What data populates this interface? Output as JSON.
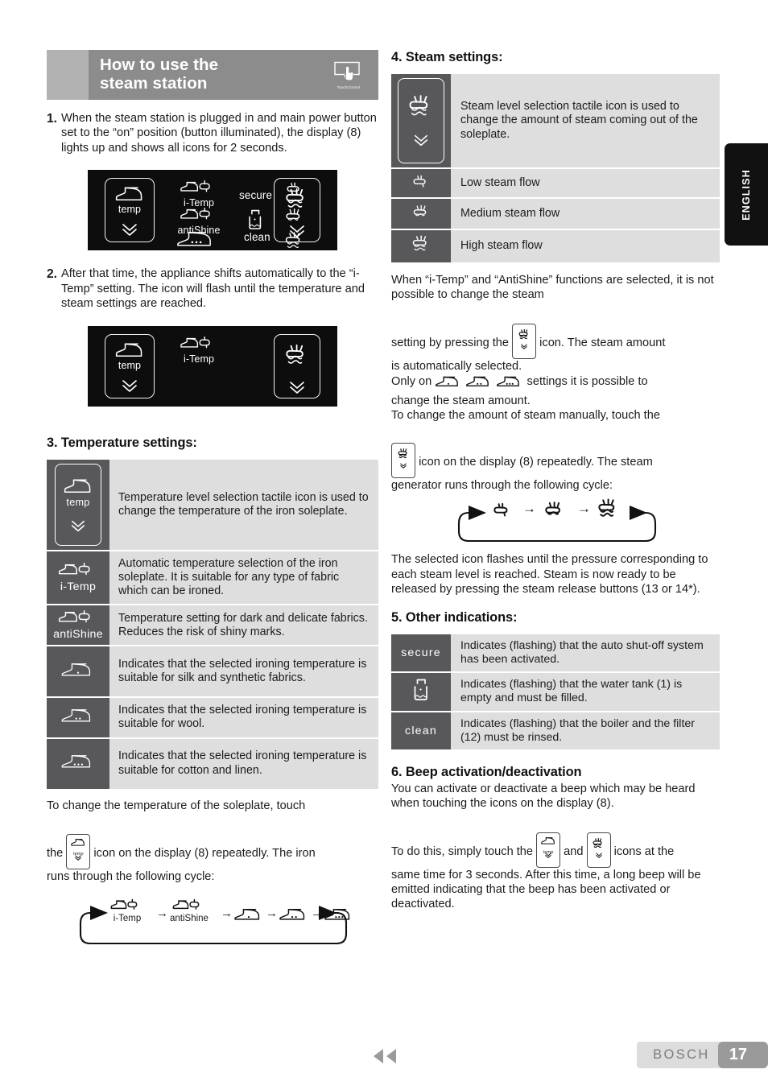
{
  "header": {
    "title": "How to use the\nsteam station",
    "touch_control_label": "TouchControl",
    "touch_control_icon": "hand-touch-icon"
  },
  "language_tab": {
    "label": "ENGLISH"
  },
  "steps": {
    "step1_number": "1.",
    "step1_text": "When the steam station is plugged in and main power button set to the “on” position (button illuminated), the display (8) lights up and shows all icons for 2 seconds.",
    "step2_number": "2.",
    "step2_text": "After that time, the appliance shifts automatically to the “i-Temp” setting. The icon will flash until the temperature and steam settings are reached."
  },
  "display_1": {
    "temp_label": "temp",
    "i_temp_label": "i-Temp",
    "antishine_label": "antiShine",
    "secure_label": "secure",
    "clean_label": "clean",
    "icons": [
      "iron-temp-tactile-icon",
      "iron-itemp-icon",
      "iron-antishine-icon",
      "iron-three-dots-icon",
      "secure-text-icon",
      "water-tank-icon",
      "clean-text-icon",
      "steam-low-icon",
      "steam-medium-icon",
      "steam-high-icon",
      "steam-tactile-icon"
    ]
  },
  "display_2": {
    "temp_label": "temp",
    "i_temp_label": "i-Temp",
    "icons": [
      "iron-temp-tactile-icon",
      "iron-itemp-icon",
      "steam-tactile-icon"
    ]
  },
  "section3": {
    "heading": "3. Temperature settings:",
    "rows": [
      {
        "icon": "iron-temp-tactile-icon",
        "icon_label": "temp",
        "description": "Temperature level selection tactile icon is used to change the temperature of the iron soleplate."
      },
      {
        "icon": "iron-itemp-icon",
        "icon_label": "i-Temp",
        "description": "Automatic temperature selection of the iron soleplate. It is suitable for any type of fabric which can be ironed."
      },
      {
        "icon": "iron-antishine-icon",
        "icon_label": "antiShine",
        "description": "Temperature setting for dark and delicate fabrics. Reduces the risk of shiny marks."
      },
      {
        "icon": "iron-one-dot-icon",
        "icon_label": "",
        "description": "Indicates that the selected ironing temperature is suitable for silk and synthetic fabrics."
      },
      {
        "icon": "iron-two-dots-icon",
        "icon_label": "",
        "description": "Indicates that the selected ironing temperature is suitable for wool."
      },
      {
        "icon": "iron-three-dots-icon",
        "icon_label": "",
        "description": "Indicates that the selected ironing temperature is suitable for cotton and linen."
      }
    ],
    "after_text_1": "To change the temperature of the soleplate, touch",
    "after_text_2": "the",
    "after_text_3": "icon on the display (8) repeatedly. The iron",
    "after_text_4": "runs through the following cycle:",
    "chip_label": "temp",
    "cycle": {
      "type": "loop",
      "steps": [
        "i-Temp",
        "antiShine",
        "iron-one-dot-icon",
        "iron-two-dots-icon",
        "iron-three-dots-icon"
      ],
      "arrow": "→"
    }
  },
  "section4": {
    "heading": "4. Steam settings:",
    "rows": [
      {
        "icon": "steam-tactile-icon",
        "description": "Steam level selection tactile icon is used to change the amount of steam coming out of the soleplate."
      },
      {
        "icon": "steam-low-icon",
        "description": "Low steam flow"
      },
      {
        "icon": "steam-medium-icon",
        "description": "Medium steam flow"
      },
      {
        "icon": "steam-high-icon",
        "description": "High steam flow"
      }
    ],
    "para_1": "When “i-Temp” and “AntiShine” functions are selected, it is not possible to change the steam",
    "para_2a": "setting by pressing the",
    "para_2b": "icon. The steam amount",
    "para_2c": "is automatically selected.",
    "para_3a": "Only on",
    "para_3b": "settings it is possible to",
    "para_3c": "change the steam amount.",
    "para_4": "To change the amount of steam manually, touch the",
    "para_5a": "icon on the display (8) repeatedly. The steam",
    "para_5b": "generator runs through the following cycle:",
    "cycle": {
      "type": "loop",
      "steps": [
        "steam-low-icon",
        "steam-medium-icon",
        "steam-high-icon"
      ],
      "arrow": "→"
    },
    "para_6": "The selected icon flashes until the pressure corresponding to each steam level is reached. Steam is now ready to be released by pressing the steam release buttons (13 or 14*)."
  },
  "section5": {
    "heading": "5. Other indications:",
    "rows": [
      {
        "icon": "secure-text-icon",
        "icon_label": "secure",
        "description": "Indicates (flashing) that the auto shut-off system has been activated."
      },
      {
        "icon": "water-tank-icon",
        "icon_label": "",
        "description": "Indicates (flashing) that the water tank (1) is empty and must be filled."
      },
      {
        "icon": "clean-text-icon",
        "icon_label": "clean",
        "description": "Indicates (flashing) that the boiler and the filter (12) must be rinsed."
      }
    ]
  },
  "section6": {
    "heading": "6. Beep activation/deactivation",
    "para_1": "You can activate or deactivate a beep which may be heard when touching the icons on the display (8).",
    "para_2a": "To do this, simply touch the",
    "para_2b": "and",
    "para_2c": "icons at the",
    "para_3": "same time for 3 seconds. After this time, a long beep will be emitted indicating that the beep has been activated or deactivated.",
    "chip_temp_label": "temp"
  },
  "footer": {
    "back_arrows_icon": "double-left-arrow-icon",
    "brand": "BOSCH",
    "page_number": "17"
  },
  "colors": {
    "banner_dark": "#8c8c8c",
    "banner_light": "#b2b2b2",
    "table_icon_bg": "#58585a",
    "table_desc_bg": "#dededf",
    "lcd_bg": "#0d0d0d",
    "page_pill": "#9a9a9a",
    "brand_pill": "#dcdcdc"
  }
}
